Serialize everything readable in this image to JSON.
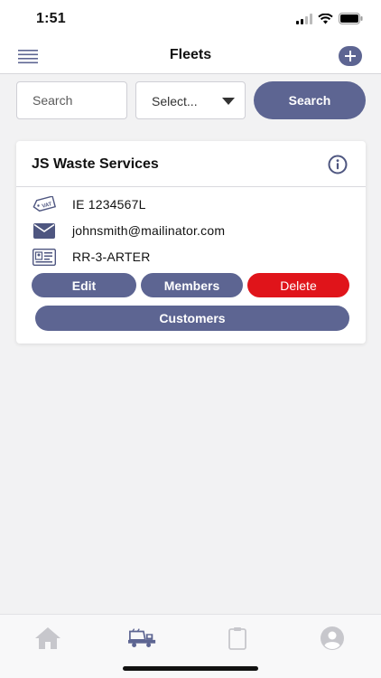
{
  "status_bar": {
    "time": "1:51"
  },
  "header": {
    "title": "Fleets"
  },
  "search": {
    "placeholder": "Search",
    "select_value": "Select...",
    "button_label": "Search"
  },
  "fleet_card": {
    "name": "JS Waste Services",
    "vat": "IE 1234567L",
    "email": "johnsmith@mailinator.com",
    "registration": "RR-3-ARTER",
    "buttons": {
      "edit": "Edit",
      "members": "Members",
      "delete": "Delete",
      "customers": "Customers"
    }
  },
  "tab_bar": {
    "icons": [
      "home-icon",
      "truck-icon",
      "clipboard-icon",
      "profile-icon"
    ],
    "active": "truck-icon"
  },
  "colors": {
    "accent": "#5d6592",
    "danger": "#e0141a",
    "background": "#f2f2f3",
    "inactive_icon": "#c7c7cc"
  }
}
